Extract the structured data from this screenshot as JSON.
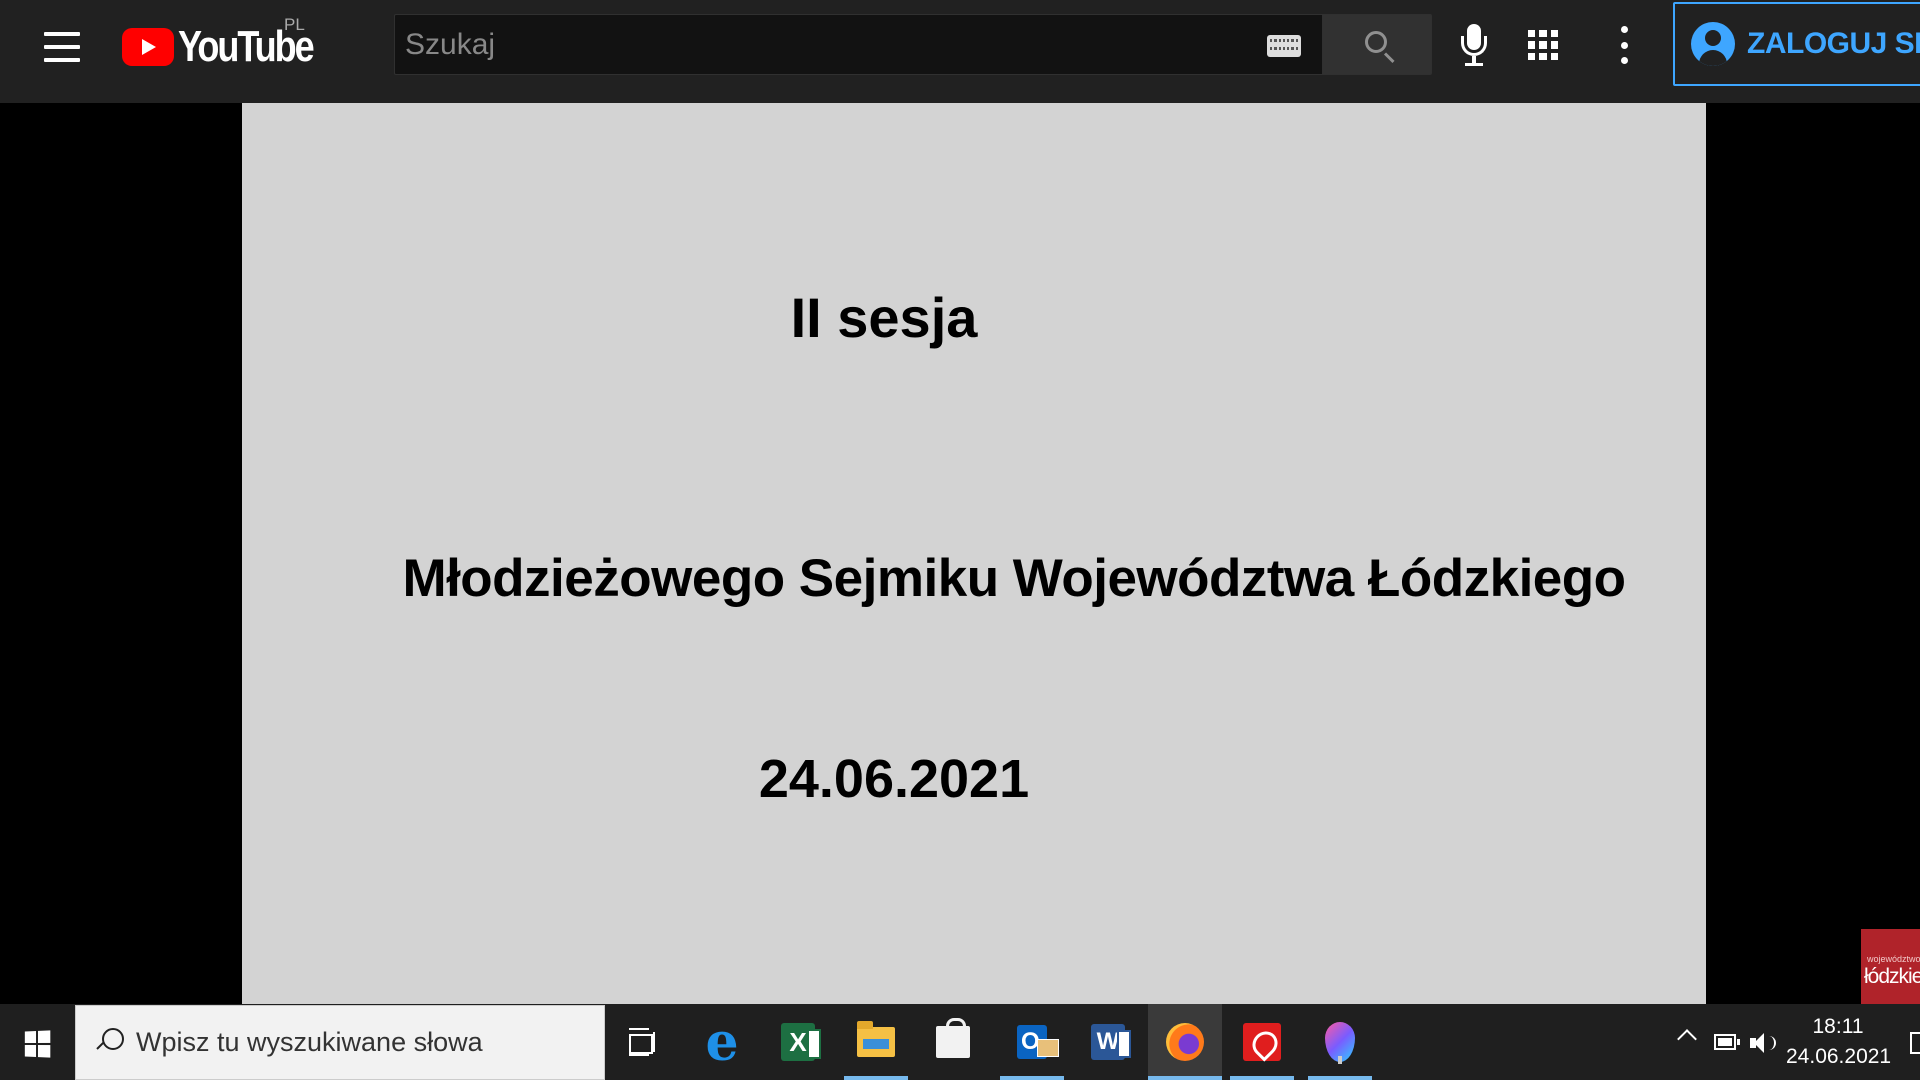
{
  "youtube": {
    "wordmark": "YouTube",
    "country_code": "PL",
    "search": {
      "placeholder": "Szukaj"
    },
    "sign_in_label": "ZALOGUJ SIĘ"
  },
  "video": {
    "slide_lines": [
      "II sesja",
      "Młodzieżowego Sejmiku Województwa Łódzkiego",
      "24.06.2021"
    ],
    "watermark": {
      "small": "województwo",
      "big": "łódzkie"
    }
  },
  "taskbar": {
    "search_placeholder": "Wpisz tu wyszukiwane słowa",
    "apps": [
      {
        "name": "task-view",
        "icon": "task-view-icon"
      },
      {
        "name": "edge",
        "icon": "edge-icon",
        "glyph": "e"
      },
      {
        "name": "excel",
        "icon": "excel-icon",
        "glyph": "X"
      },
      {
        "name": "file-explorer",
        "icon": "folder-icon"
      },
      {
        "name": "microsoft-store",
        "icon": "store-icon"
      },
      {
        "name": "outlook",
        "icon": "outlook-icon",
        "glyph": "O"
      },
      {
        "name": "word",
        "icon": "word-icon",
        "glyph": "W"
      },
      {
        "name": "firefox",
        "icon": "firefox-icon",
        "active": true
      },
      {
        "name": "acrobat",
        "icon": "acrobat-icon"
      },
      {
        "name": "maps",
        "icon": "maps-icon"
      }
    ],
    "clock": {
      "time": "18:11",
      "date": "24.06.2021"
    }
  },
  "colors": {
    "youtube_bar": "#212121",
    "youtube_red": "#ff0000",
    "signin_blue": "#3ea6ff",
    "slide_bg": "#d3d3d3",
    "taskbar_bg": "#1f1f1f",
    "taskbar_underline": "#76b9ed"
  }
}
